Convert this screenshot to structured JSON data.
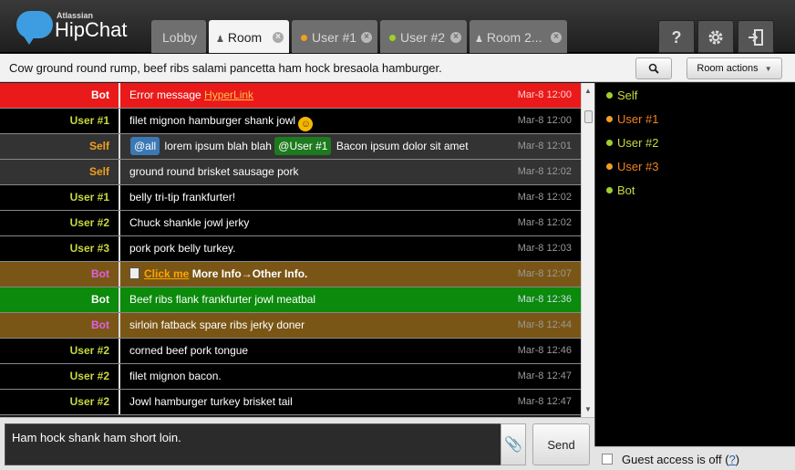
{
  "app": {
    "brand_small": "Atlassian",
    "brand_name": "HipChat"
  },
  "tabs": [
    {
      "label": "Lobby"
    },
    {
      "label": "Room",
      "icon": "users-icon"
    },
    {
      "label": "User #1",
      "status_color": "#f0a020"
    },
    {
      "label": "User #2",
      "status_color": "#9fd02a"
    },
    {
      "label": "Room 2...",
      "icon": "users-icon"
    }
  ],
  "toolbar": {
    "help": "?",
    "settings_icon": "gear-icon",
    "logout_icon": "exit-icon"
  },
  "topic": "Cow ground round rump, beef ribs salami pancetta ham hock bresaola hamburger.",
  "room_actions_label": "Room actions",
  "messages": [
    {
      "sender": "Bot",
      "text": "Error message ",
      "link": "HyperLink",
      "time": "Mar-8 12:00"
    },
    {
      "sender": "User #1",
      "text": "filet mignon hamburger shank jowl",
      "time": "Mar-8 12:00"
    },
    {
      "sender": "Self",
      "mention1": "@all",
      "text": "lorem ipsum blah blah",
      "mention2": "@User #1",
      "text2": "Bacon ipsum dolor sit amet",
      "time": "Mar-8 12:01"
    },
    {
      "sender": "Self",
      "text": "ground round brisket sausage pork",
      "time": "Mar-8 12:02"
    },
    {
      "sender": "User #1",
      "text": "belly tri-tip frankfurter!",
      "time": "Mar-8 12:02"
    },
    {
      "sender": "User #2",
      "text": "Chuck shankle jowl jerky",
      "time": "Mar-8 12:02"
    },
    {
      "sender": "User #3",
      "text": "pork pork belly turkey.",
      "time": "Mar-8 12:03"
    },
    {
      "sender": "Bot",
      "link": "Click me",
      "text": "More Info→Other Info",
      "suffix": ".",
      "time": "Mar-8 12:07"
    },
    {
      "sender": "Bot",
      "text": "Beef ribs flank frankfurter jowl meatbal",
      "time": "Mar-8 12:36"
    },
    {
      "sender": "Bot",
      "text": "sirloin fatback spare ribs jerky doner",
      "time": "Mar-8 12:44"
    },
    {
      "sender": "User #2",
      "text": "corned beef pork tongue",
      "time": "Mar-8 12:46"
    },
    {
      "sender": "User #2",
      "text": "filet mignon bacon.",
      "time": "Mar-8 12:47"
    },
    {
      "sender": "User #2",
      "text": "Jowl hamburger turkey brisket tail",
      "time": "Mar-8 12:47"
    }
  ],
  "input": {
    "value": "Ham hock shank ham short loin."
  },
  "send_label": "Send",
  "roster": [
    {
      "name": "Self",
      "status_color": "#9fd02a",
      "name_color": "#c8d840"
    },
    {
      "name": "User #1",
      "status_color": "#f0a020",
      "name_color": "#f08020"
    },
    {
      "name": "User #2",
      "status_color": "#9fd02a",
      "name_color": "#c8d840"
    },
    {
      "name": "User #3",
      "status_color": "#f0a020",
      "name_color": "#f08020"
    },
    {
      "name": "Bot",
      "status_color": "#9fd02a",
      "name_color": "#c8d840"
    }
  ],
  "guest": {
    "text": "Guest access is off (",
    "link": "?",
    "close": ")"
  },
  "colors": {
    "error_row": "#ea1a1a",
    "black_row": "#000000",
    "self_row": "#333333",
    "brown_row": "#7a5616",
    "green_row": "#0b8a0b",
    "mention_all": "#3b78b4",
    "mention_user": "#1e7a1e",
    "link_orange": "#ffa500"
  }
}
